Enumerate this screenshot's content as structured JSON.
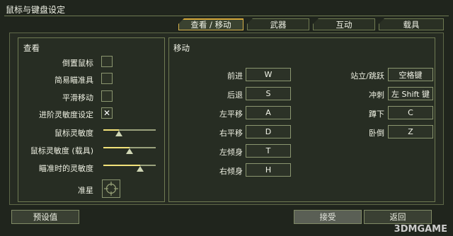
{
  "window": {
    "title": "鼠标与键盘设定"
  },
  "tabs": [
    {
      "label": "查看 / 移动",
      "active": true
    },
    {
      "label": "武器",
      "active": false
    },
    {
      "label": "互动",
      "active": false
    },
    {
      "label": "载具",
      "active": false
    }
  ],
  "view_panel": {
    "title": "查看",
    "options": [
      {
        "label": "倒置鼠标",
        "checked": false
      },
      {
        "label": "简易瞄准具",
        "checked": false
      },
      {
        "label": "平滑移动",
        "checked": false
      },
      {
        "label": "进阶灵敏度设定",
        "checked": true,
        "mark": "✕"
      }
    ],
    "sliders": [
      {
        "label": "鼠标灵敏度",
        "fraction": 0.3
      },
      {
        "label": "鼠标灵敏度 (载具)",
        "fraction": 0.5
      },
      {
        "label": "瞄准时的灵敏度",
        "fraction": 0.7
      }
    ],
    "crosshair_label": "准星"
  },
  "move_panel": {
    "title": "移动",
    "left_bindings": [
      {
        "action": "前进",
        "key": "W"
      },
      {
        "action": "后退",
        "key": "S"
      },
      {
        "action": "左平移",
        "key": "A"
      },
      {
        "action": "右平移",
        "key": "D"
      },
      {
        "action": "左倾身",
        "key": "T"
      },
      {
        "action": "右倾身",
        "key": "H"
      }
    ],
    "right_bindings": [
      {
        "action": "站立/跳跃",
        "key": "空格键"
      },
      {
        "action": "冲刺",
        "key": "左 Shift 键"
      },
      {
        "action": "蹲下",
        "key": "C"
      },
      {
        "action": "卧倒",
        "key": "Z"
      }
    ]
  },
  "footer": {
    "preset": "预设值",
    "accept": "接受",
    "back": "返回"
  },
  "watermark": "3DMGAME",
  "colors": {
    "accent": "#d6a83a",
    "border": "#6f7a52",
    "background": "#20251d"
  }
}
